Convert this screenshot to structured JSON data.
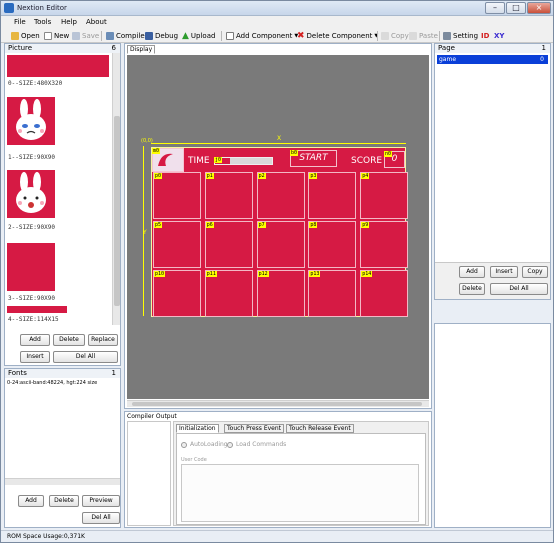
{
  "window": {
    "title": "Nextion Editor"
  },
  "menu": {
    "file": "File",
    "tools": "Tools",
    "help": "Help",
    "about": "About"
  },
  "toolbar": {
    "open": "Open",
    "new": "New",
    "save": "Save",
    "compile": "Compile",
    "debug": "Debug",
    "upload": "Upload",
    "add_component": "Add Component",
    "delete_component": "Delete Component",
    "copy": "Copy",
    "paste": "Paste",
    "setting": "Setting",
    "id": "ID",
    "xy": "XY"
  },
  "picture_panel": {
    "title": "Picture",
    "count": "6",
    "items": [
      {
        "label": "0--SIZE:480X320"
      },
      {
        "label": "1--SIZE:90X90"
      },
      {
        "label": "2--SIZE:90X90"
      },
      {
        "label": "3--SIZE:90X90"
      },
      {
        "label": "4--SIZE:114X15"
      }
    ],
    "buttons": {
      "add": "Add",
      "delete": "Delete",
      "replace": "Replace",
      "insert": "Insert",
      "del_all": "Del All"
    }
  },
  "fonts_panel": {
    "title": "Fonts",
    "count": "1",
    "item": "0-24:ascii-band:48224, hgt:224 size",
    "buttons": {
      "add": "Add",
      "delete": "Delete",
      "preview": "Preview",
      "del_all": "Del All"
    }
  },
  "display": {
    "tab": "Display",
    "origin": "(0,0)",
    "x_axis": "X",
    "y_axis": "Y",
    "hud": {
      "time": "TIME",
      "start": "START",
      "score": "SCORE",
      "score_value": "0"
    },
    "tags": {
      "m0": "m0",
      "j0": "j0",
      "b0": "b0",
      "n0": "n0",
      "cells": [
        "p0",
        "p1",
        "p2",
        "p3",
        "p4",
        "p5",
        "p6",
        "p7",
        "p8",
        "p9",
        "p10",
        "p11",
        "p12",
        "p13",
        "p14"
      ]
    }
  },
  "page_panel": {
    "title": "Page",
    "count": "1",
    "items": [
      {
        "name": "game",
        "id": "0"
      }
    ],
    "buttons": {
      "add": "Add",
      "insert": "Insert",
      "copy": "Copy",
      "delete": "Delete",
      "del_all": "Del All"
    }
  },
  "compiler": {
    "title": "Compiler Output"
  },
  "events": {
    "tabs": [
      "Initialization",
      "Touch Press Event",
      "Touch Release Event"
    ],
    "options": [
      "AutoLoading",
      "Load Commands"
    ],
    "user_code": "User Code"
  },
  "status": {
    "rom": "ROM Space Usage:0,371K"
  },
  "colors": {
    "accent": "#d61a44",
    "tag": "#ffff00",
    "canvas": "#7a7a7a"
  }
}
